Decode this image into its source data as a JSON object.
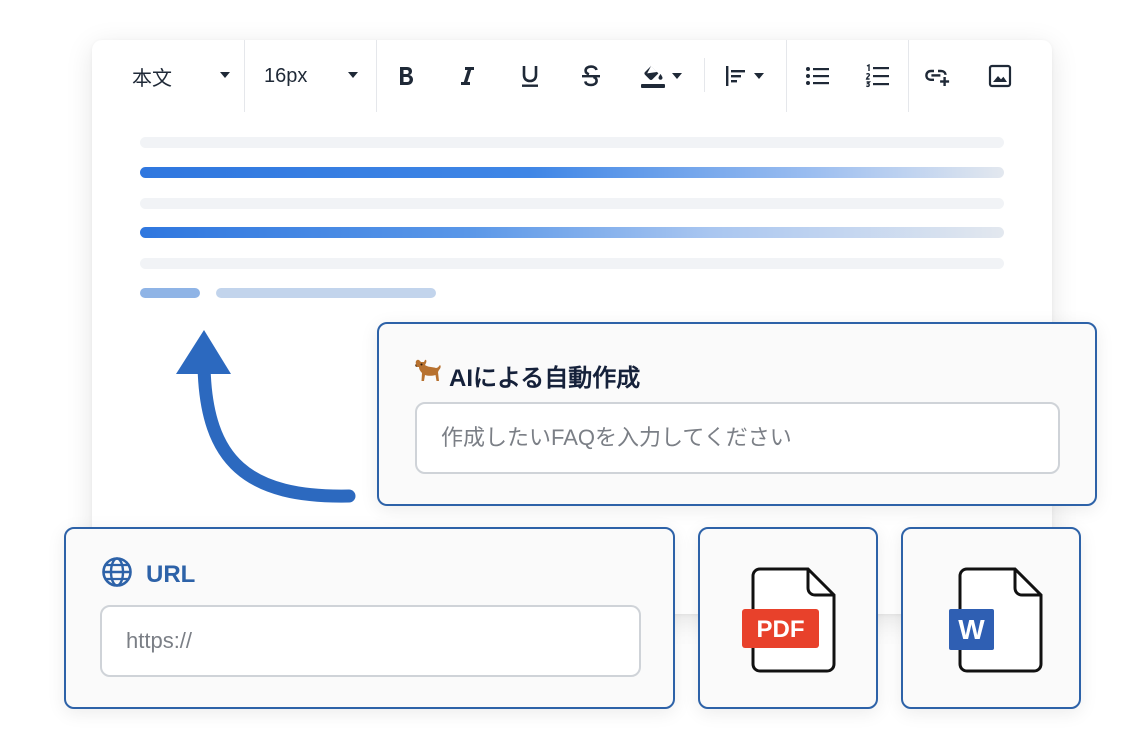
{
  "toolbar": {
    "block_style": "本文",
    "font_size": "16px",
    "buttons": [
      "bold",
      "italic",
      "underline",
      "strikethrough",
      "text-color",
      "align",
      "bullet-list",
      "numbered-list",
      "link",
      "image"
    ]
  },
  "ai_card": {
    "title": "AIによる自動作成",
    "placeholder": "作成したいFAQを入力してください"
  },
  "url_card": {
    "title": "URL",
    "placeholder": "https://"
  },
  "pdf_card": {
    "badge": "PDF"
  },
  "word_card": {
    "badge": "W"
  },
  "colors": {
    "accent_border": "#2d62a8",
    "arrow": "#2c69bf",
    "pdf_red": "#e8412b",
    "word_blue": "#2f5fb3",
    "text_color_bar": "#1f2937"
  },
  "icons": {
    "ai_card": "dog-icon",
    "url_card": "globe-icon"
  }
}
